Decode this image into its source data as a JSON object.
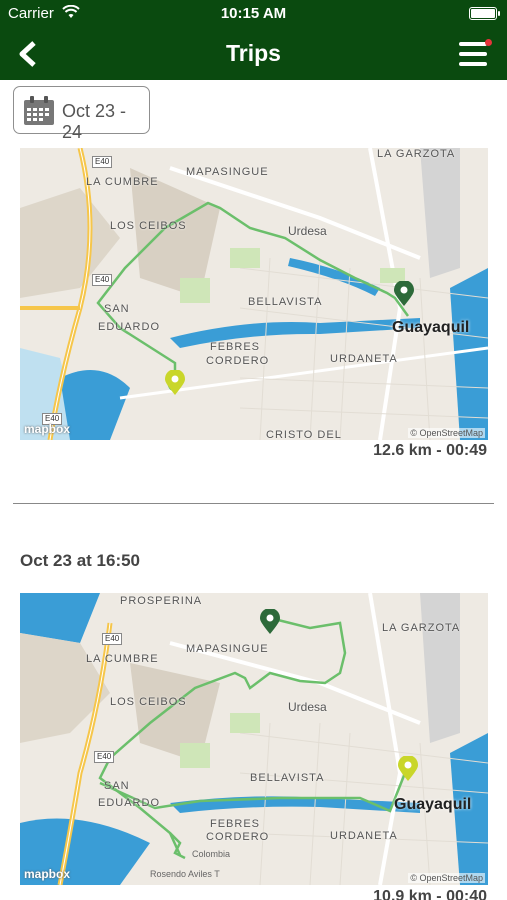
{
  "status_bar": {
    "carrier": "Carrier",
    "time": "10:15 AM"
  },
  "nav": {
    "title": "Trips"
  },
  "filter": {
    "date_range": "Oct 23 - 24"
  },
  "colors": {
    "header": "#0a4a0f",
    "route": "#6bbf6b",
    "start_pin": "#2d6a3a",
    "end_pin": "#c9d62a",
    "water": "#3a9dd6"
  },
  "map_labels": {
    "la_garzota": "LA GARZOTA",
    "mapasingue": "MAPASINGUE",
    "la_cumbre": "LA CUMBRE",
    "los_ceibos": "LOS CEIBOS",
    "urdesa": "Urdesa",
    "bellavista": "BELLAVISTA",
    "san": "SAN",
    "eduardo": "EDUARDO",
    "febres": "FEBRES",
    "cordero": "CORDERO",
    "urdaneta": "URDANETA",
    "cristo_del": "CRISTO DEL",
    "guayaquil": "Guayaquil",
    "prosperina": "PROSPERINA",
    "colombia": "Colombia",
    "rosendo": "Rosendo Aviles T",
    "e40": "E40",
    "mapbox": "mapbox",
    "attribution": "© OpenStreetMap"
  },
  "trips": [
    {
      "heading": "",
      "stats": "12.6 km - 00:49"
    },
    {
      "heading": "Oct 23 at 16:50",
      "stats": "10.9 km - 00:40"
    }
  ]
}
